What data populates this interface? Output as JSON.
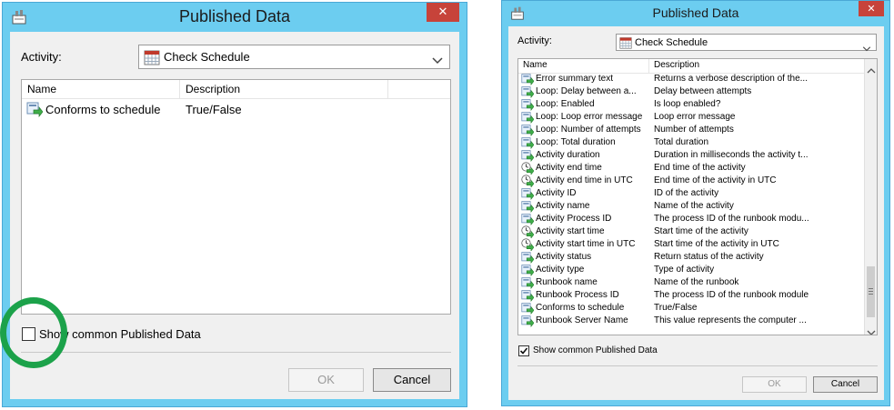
{
  "left_dialog": {
    "title": "Published Data",
    "close_label": "✕",
    "activity_label": "Activity:",
    "activity_value": "Check Schedule",
    "columns": {
      "name": "Name",
      "description": "Description"
    },
    "rows": [
      {
        "name": "Conforms to schedule",
        "description": "True/False"
      }
    ],
    "show_common_label": "Show common Published Data",
    "show_common_checked": false,
    "ok_label": "OK",
    "cancel_label": "Cancel"
  },
  "right_dialog": {
    "title": "Published Data",
    "close_label": "✕",
    "activity_label": "Activity:",
    "activity_value": "Check Schedule",
    "columns": {
      "name": "Name",
      "description": "Description"
    },
    "rows": [
      {
        "name": "Error summary text",
        "description": "Returns a verbose description of the..."
      },
      {
        "name": "Loop: Delay between a...",
        "description": "Delay between attempts"
      },
      {
        "name": "Loop: Enabled",
        "description": "Is loop enabled?"
      },
      {
        "name": "Loop: Loop error message",
        "description": "Loop error message"
      },
      {
        "name": "Loop: Number of attempts",
        "description": "Number of attempts"
      },
      {
        "name": "Loop: Total duration",
        "description": "Total duration"
      },
      {
        "name": "Activity duration",
        "description": "Duration in milliseconds the activity t..."
      },
      {
        "name": "Activity end time",
        "description": "End time of the activity"
      },
      {
        "name": "Activity end time in UTC",
        "description": "End time of the activity in UTC"
      },
      {
        "name": "Activity ID",
        "description": "ID of the activity"
      },
      {
        "name": "Activity name",
        "description": "Name of the activity"
      },
      {
        "name": "Activity Process ID",
        "description": "The process ID of the runbook modu..."
      },
      {
        "name": "Activity start time",
        "description": "Start time of the activity"
      },
      {
        "name": "Activity start time in UTC",
        "description": "Start time of the activity in UTC"
      },
      {
        "name": "Activity status",
        "description": "Return status of the activity"
      },
      {
        "name": "Activity type",
        "description": "Type of activity"
      },
      {
        "name": "Runbook name",
        "description": "Name of the runbook"
      },
      {
        "name": "Runbook Process ID",
        "description": "The process ID of the runbook module"
      },
      {
        "name": "Conforms to schedule",
        "description": "True/False"
      },
      {
        "name": "Runbook Server Name",
        "description": "This value represents the computer ..."
      }
    ],
    "show_common_label": "Show common Published Data",
    "show_common_checked": true,
    "ok_label": "OK",
    "cancel_label": "Cancel"
  },
  "colors": {
    "frame": "#6ccdf0",
    "close": "#c7433a",
    "highlight_ring": "#1ca24a"
  },
  "icons": {
    "app": "app-icon",
    "calendar": "calendar-icon",
    "published_data_row": "published-data-icon",
    "clock_row": "clock-icon"
  }
}
